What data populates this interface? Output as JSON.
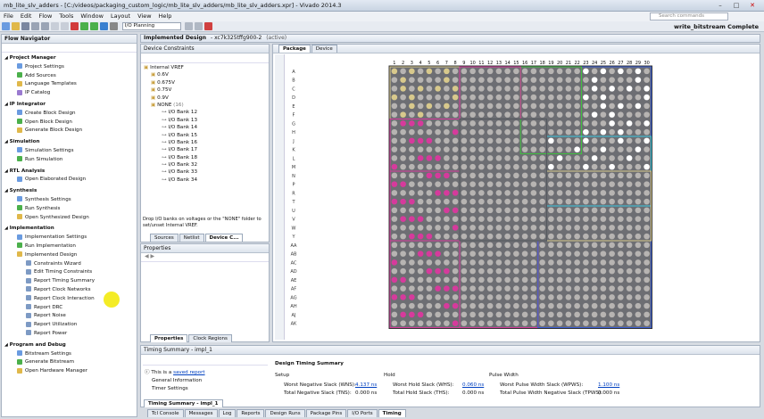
{
  "window": {
    "title": "mb_lite_slv_adders - [C:/videos/packaging_custom_logic/mb_lite_slv_adders/mb_lite_slv_adders.xpr] - Vivado 2014.3"
  },
  "menu": [
    "File",
    "Edit",
    "Flow",
    "Tools",
    "Window",
    "Layout",
    "View",
    "Help"
  ],
  "search": {
    "placeholder": "Search commands"
  },
  "toolbar": {
    "layout": "I/O Planning",
    "status": "write_bitstream Complete"
  },
  "flow_navigator": {
    "title": "Flow Navigator",
    "sections": [
      {
        "label": "Project Manager",
        "items": [
          "Project Settings",
          "Add Sources",
          "Language Templates",
          "IP Catalog"
        ]
      },
      {
        "label": "IP Integrator",
        "items": [
          "Create Block Design",
          "Open Block Design",
          "Generate Block Design"
        ]
      },
      {
        "label": "Simulation",
        "items": [
          "Simulation Settings",
          "Run Simulation"
        ]
      },
      {
        "label": "RTL Analysis",
        "items": [
          "Open Elaborated Design"
        ]
      },
      {
        "label": "Synthesis",
        "items": [
          "Synthesis Settings",
          "Run Synthesis",
          "Open Synthesized Design"
        ]
      },
      {
        "label": "Implementation",
        "items": [
          "Implementation Settings",
          "Run Implementation",
          "Implemented Design"
        ],
        "sub": [
          "Constraints Wizard",
          "Edit Timing Constraints",
          "Report Timing Summary",
          "Report Clock Networks",
          "Report Clock Interaction",
          "Report DRC",
          "Report Noise",
          "Report Utilization",
          "Report Power"
        ]
      },
      {
        "label": "Program and Debug",
        "items": [
          "Bitstream Settings",
          "Generate Bitstream",
          "Open Hardware Manager"
        ]
      }
    ]
  },
  "design": {
    "header": "Implemented Design",
    "part": "- xc7k325tffg900-2",
    "state": "(active)"
  },
  "device_constraints": {
    "title": "Device Constraints",
    "root": "Internal VREF",
    "vrefs": [
      "0.6V",
      "0.675V",
      "0.75V",
      "0.9V"
    ],
    "none_label": "NONE",
    "none_count": "(16)",
    "banks": [
      "I/O Bank 12",
      "I/O Bank 13",
      "I/O Bank 14",
      "I/O Bank 15",
      "I/O Bank 16",
      "I/O Bank 17",
      "I/O Bank 18",
      "I/O Bank 32",
      "I/O Bank 33",
      "I/O Bank 34"
    ],
    "hint": "Drop I/O banks on voltages or the \"NONE\" folder to set/unset Internal VREF.",
    "tabs": [
      "Sources",
      "Netlist",
      "Device C..."
    ]
  },
  "properties": {
    "title": "Properties",
    "tabs": [
      "Properties",
      "Clock Regions"
    ]
  },
  "package_view": {
    "tabs": [
      "Package",
      "Device"
    ],
    "cols": [
      "1",
      "2",
      "3",
      "4",
      "5",
      "6",
      "7",
      "8",
      "9",
      "10",
      "11",
      "12",
      "13",
      "14",
      "15",
      "16",
      "17",
      "18",
      "19",
      "20",
      "21",
      "22",
      "23",
      "24",
      "25",
      "26",
      "27",
      "28",
      "29",
      "30"
    ],
    "rows": [
      "A",
      "B",
      "C",
      "D",
      "E",
      "F",
      "G",
      "H",
      "J",
      "K",
      "L",
      "M",
      "N",
      "P",
      "R",
      "T",
      "U",
      "V",
      "W",
      "Y",
      "AA",
      "AB",
      "AC",
      "AD",
      "AE",
      "AF",
      "AG",
      "AH",
      "AJ",
      "AK"
    ]
  },
  "timing": {
    "title": "Timing Summary - impl_1",
    "saved_note": "This is a",
    "saved_link": "saved report",
    "tree": [
      "General Information",
      "Timer Settings"
    ],
    "header": "Design Timing Summary",
    "cols": [
      "Setup",
      "Hold",
      "Pulse Width"
    ],
    "wns_label": "Worst Negative Slack (WNS):",
    "wns": "4.137 ns",
    "tns_label": "Total Negative Slack (TNS):",
    "tns": "0.000 ns",
    "whs_label": "Worst Hold Slack (WHS):",
    "whs": "0.060 ns",
    "ths_label": "Total Hold Slack (THS):",
    "ths": "0.000 ns",
    "wpws_label": "Worst Pulse Width Slack (WPWS):",
    "wpws": "1.100 ns",
    "tpws_label": "Total Pulse Width Negative Slack (TPWS):",
    "tpws": "0.000 ns",
    "subtab": "Timing Summary - impl_1"
  },
  "bottom_tabs": [
    "Tcl Console",
    "Messages",
    "Log",
    "Reports",
    "Design Runs",
    "Package Pins",
    "I/O Ports",
    "Timing"
  ],
  "colors": {
    "pin": "#b7b4b2",
    "bank_yellow": "#d8c98c",
    "bank_magenta": "#d63a9c",
    "bank_blue": "#3a5ed6",
    "bank_green": "#40c040",
    "bank_cyan": "#3bc8e0"
  }
}
